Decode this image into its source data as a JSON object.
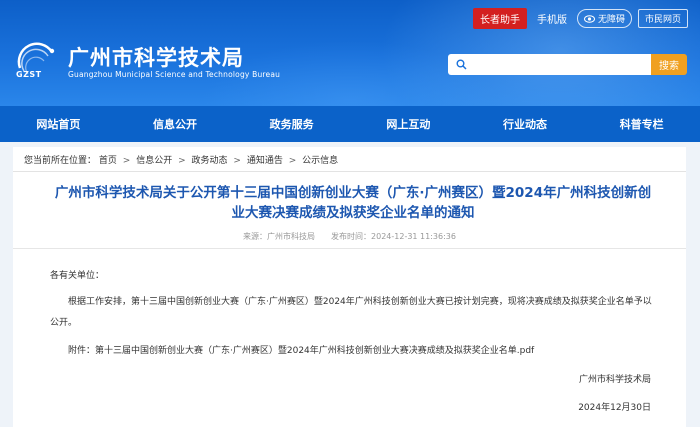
{
  "top_links": {
    "elderly": "长者助手",
    "mobile": "手机版",
    "accessible": "无障碍",
    "citizen": "市民网页"
  },
  "site": {
    "logo_text": "GZST",
    "title": "广州市科学技术局",
    "subtitle": "Guangzhou Municipal Science and Technology Bureau"
  },
  "search": {
    "placeholder": "",
    "button": "搜索"
  },
  "nav": [
    "网站首页",
    "信息公开",
    "政务服务",
    "网上互动",
    "行业动态",
    "科普专栏"
  ],
  "breadcrumb": {
    "prefix": "您当前所在位置：",
    "items": [
      "首页",
      "信息公开",
      "政务动态",
      "通知通告",
      "公示信息"
    ]
  },
  "article": {
    "title": "广州市科学技术局关于公开第十三届中国创新创业大赛（广东·广州赛区）暨2024年广州科技创新创业大赛决赛成绩及拟获奖企业名单的通知",
    "meta": "来源：广州市科技局　　发布时间：2024-12-31 11:36:36",
    "salutation": "各有关单位：",
    "paragraph": "根据工作安排，第十三届中国创新创业大赛（广东·广州赛区）暨2024年广州科技创新创业大赛已按计划完赛，现将决赛成绩及拟获奖企业名单予以公开。",
    "attachment": "附件：第十三届中国创新创业大赛（广东·广州赛区）暨2024年广州科技创新创业大赛决赛成绩及拟获奖企业名单.pdf",
    "signature": "广州市科学技术局",
    "date": "2024年12月30日"
  },
  "colors": {
    "header_blue": "#1a72dc",
    "nav_blue": "#0b62c9",
    "title_blue": "#1d57b0",
    "search_orange": "#f0a020",
    "red_button": "#d32020"
  }
}
